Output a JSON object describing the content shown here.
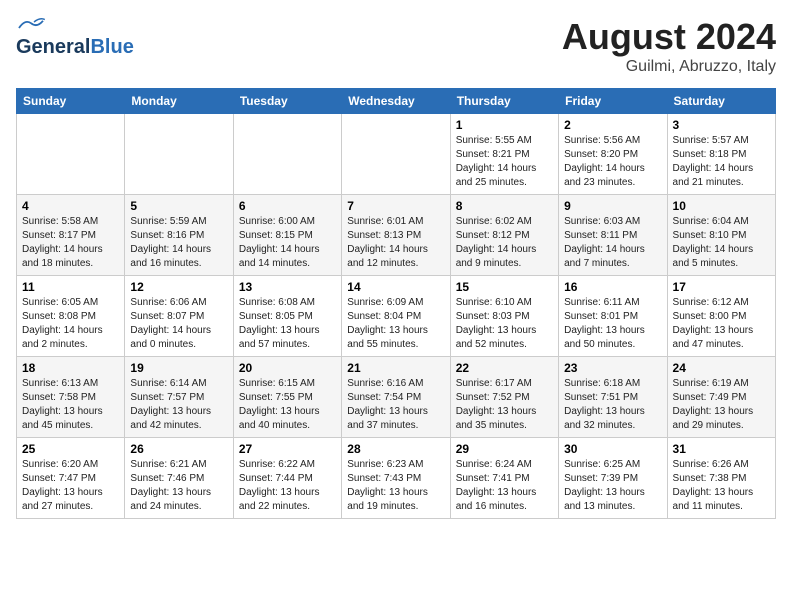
{
  "header": {
    "logo_general": "General",
    "logo_blue": "Blue",
    "title": "August 2024",
    "subtitle": "Guilmi, Abruzzo, Italy"
  },
  "weekdays": [
    "Sunday",
    "Monday",
    "Tuesday",
    "Wednesday",
    "Thursday",
    "Friday",
    "Saturday"
  ],
  "weeks": [
    [
      {
        "day": "",
        "info": ""
      },
      {
        "day": "",
        "info": ""
      },
      {
        "day": "",
        "info": ""
      },
      {
        "day": "",
        "info": ""
      },
      {
        "day": "1",
        "info": "Sunrise: 5:55 AM\nSunset: 8:21 PM\nDaylight: 14 hours\nand 25 minutes."
      },
      {
        "day": "2",
        "info": "Sunrise: 5:56 AM\nSunset: 8:20 PM\nDaylight: 14 hours\nand 23 minutes."
      },
      {
        "day": "3",
        "info": "Sunrise: 5:57 AM\nSunset: 8:18 PM\nDaylight: 14 hours\nand 21 minutes."
      }
    ],
    [
      {
        "day": "4",
        "info": "Sunrise: 5:58 AM\nSunset: 8:17 PM\nDaylight: 14 hours\nand 18 minutes."
      },
      {
        "day": "5",
        "info": "Sunrise: 5:59 AM\nSunset: 8:16 PM\nDaylight: 14 hours\nand 16 minutes."
      },
      {
        "day": "6",
        "info": "Sunrise: 6:00 AM\nSunset: 8:15 PM\nDaylight: 14 hours\nand 14 minutes."
      },
      {
        "day": "7",
        "info": "Sunrise: 6:01 AM\nSunset: 8:13 PM\nDaylight: 14 hours\nand 12 minutes."
      },
      {
        "day": "8",
        "info": "Sunrise: 6:02 AM\nSunset: 8:12 PM\nDaylight: 14 hours\nand 9 minutes."
      },
      {
        "day": "9",
        "info": "Sunrise: 6:03 AM\nSunset: 8:11 PM\nDaylight: 14 hours\nand 7 minutes."
      },
      {
        "day": "10",
        "info": "Sunrise: 6:04 AM\nSunset: 8:10 PM\nDaylight: 14 hours\nand 5 minutes."
      }
    ],
    [
      {
        "day": "11",
        "info": "Sunrise: 6:05 AM\nSunset: 8:08 PM\nDaylight: 14 hours\nand 2 minutes."
      },
      {
        "day": "12",
        "info": "Sunrise: 6:06 AM\nSunset: 8:07 PM\nDaylight: 14 hours\nand 0 minutes."
      },
      {
        "day": "13",
        "info": "Sunrise: 6:08 AM\nSunset: 8:05 PM\nDaylight: 13 hours\nand 57 minutes."
      },
      {
        "day": "14",
        "info": "Sunrise: 6:09 AM\nSunset: 8:04 PM\nDaylight: 13 hours\nand 55 minutes."
      },
      {
        "day": "15",
        "info": "Sunrise: 6:10 AM\nSunset: 8:03 PM\nDaylight: 13 hours\nand 52 minutes."
      },
      {
        "day": "16",
        "info": "Sunrise: 6:11 AM\nSunset: 8:01 PM\nDaylight: 13 hours\nand 50 minutes."
      },
      {
        "day": "17",
        "info": "Sunrise: 6:12 AM\nSunset: 8:00 PM\nDaylight: 13 hours\nand 47 minutes."
      }
    ],
    [
      {
        "day": "18",
        "info": "Sunrise: 6:13 AM\nSunset: 7:58 PM\nDaylight: 13 hours\nand 45 minutes."
      },
      {
        "day": "19",
        "info": "Sunrise: 6:14 AM\nSunset: 7:57 PM\nDaylight: 13 hours\nand 42 minutes."
      },
      {
        "day": "20",
        "info": "Sunrise: 6:15 AM\nSunset: 7:55 PM\nDaylight: 13 hours\nand 40 minutes."
      },
      {
        "day": "21",
        "info": "Sunrise: 6:16 AM\nSunset: 7:54 PM\nDaylight: 13 hours\nand 37 minutes."
      },
      {
        "day": "22",
        "info": "Sunrise: 6:17 AM\nSunset: 7:52 PM\nDaylight: 13 hours\nand 35 minutes."
      },
      {
        "day": "23",
        "info": "Sunrise: 6:18 AM\nSunset: 7:51 PM\nDaylight: 13 hours\nand 32 minutes."
      },
      {
        "day": "24",
        "info": "Sunrise: 6:19 AM\nSunset: 7:49 PM\nDaylight: 13 hours\nand 29 minutes."
      }
    ],
    [
      {
        "day": "25",
        "info": "Sunrise: 6:20 AM\nSunset: 7:47 PM\nDaylight: 13 hours\nand 27 minutes."
      },
      {
        "day": "26",
        "info": "Sunrise: 6:21 AM\nSunset: 7:46 PM\nDaylight: 13 hours\nand 24 minutes."
      },
      {
        "day": "27",
        "info": "Sunrise: 6:22 AM\nSunset: 7:44 PM\nDaylight: 13 hours\nand 22 minutes."
      },
      {
        "day": "28",
        "info": "Sunrise: 6:23 AM\nSunset: 7:43 PM\nDaylight: 13 hours\nand 19 minutes."
      },
      {
        "day": "29",
        "info": "Sunrise: 6:24 AM\nSunset: 7:41 PM\nDaylight: 13 hours\nand 16 minutes."
      },
      {
        "day": "30",
        "info": "Sunrise: 6:25 AM\nSunset: 7:39 PM\nDaylight: 13 hours\nand 13 minutes."
      },
      {
        "day": "31",
        "info": "Sunrise: 6:26 AM\nSunset: 7:38 PM\nDaylight: 13 hours\nand 11 minutes."
      }
    ]
  ]
}
